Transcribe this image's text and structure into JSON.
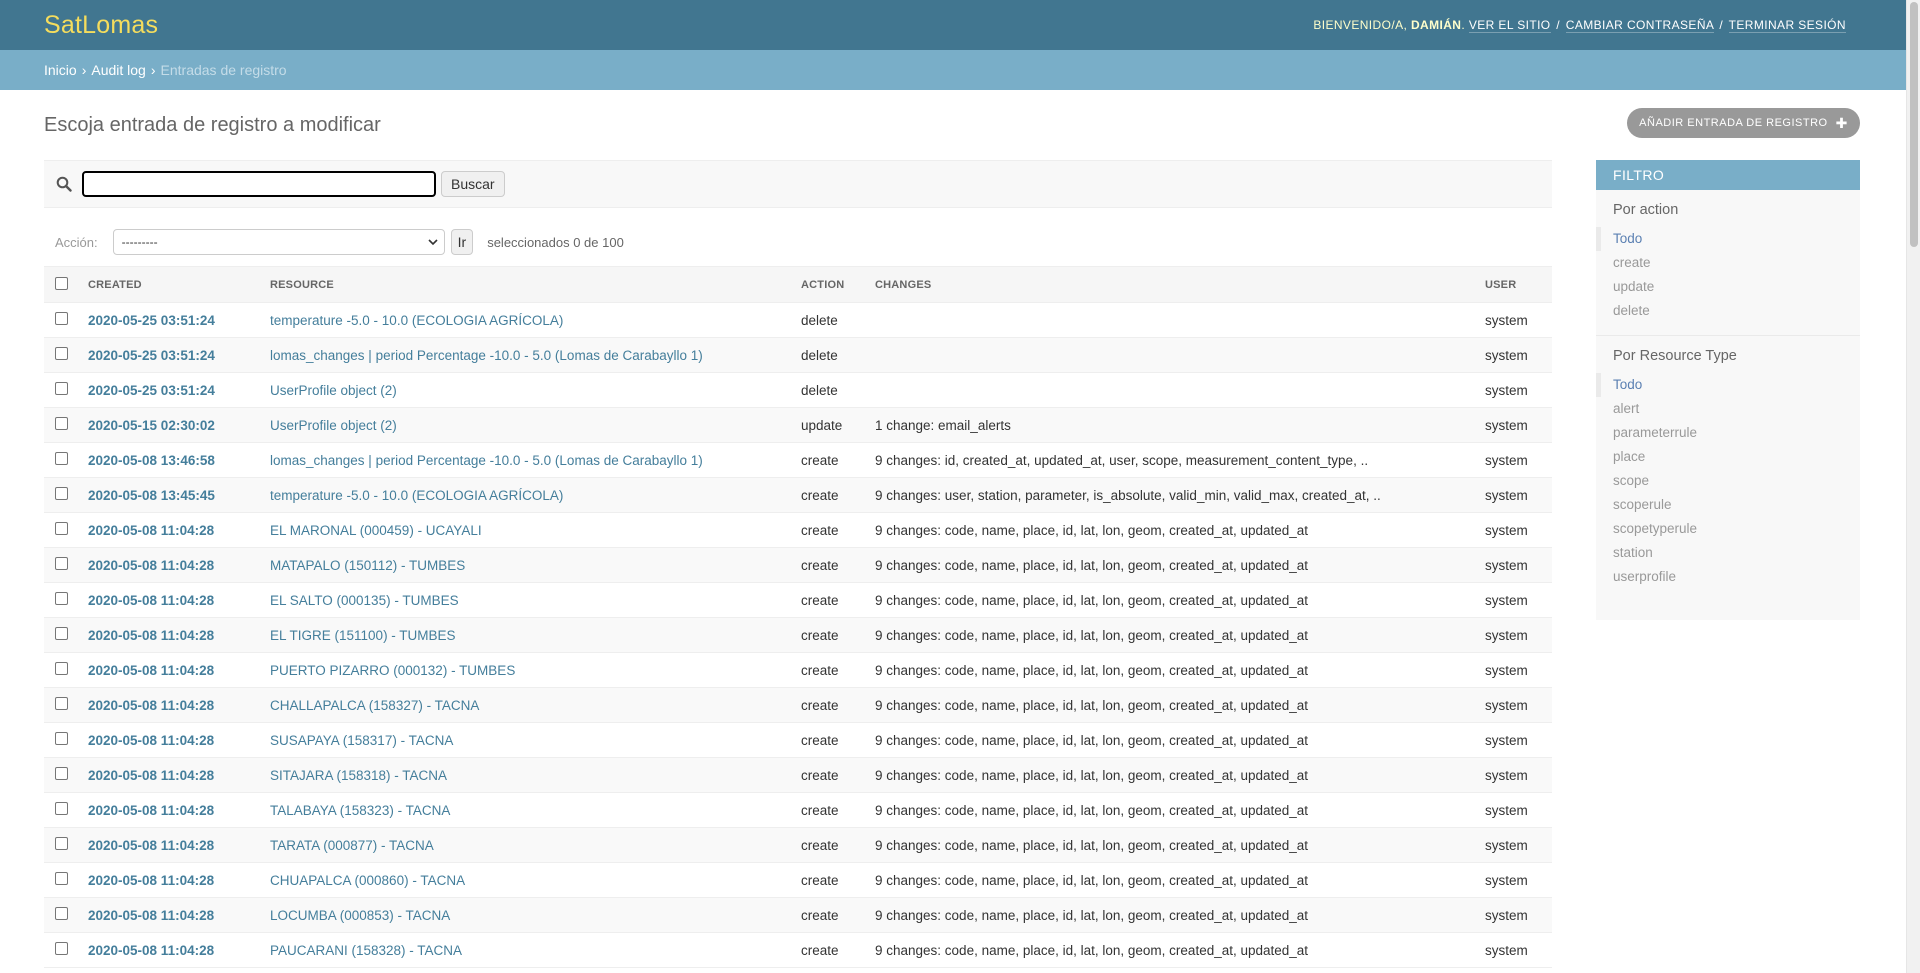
{
  "header": {
    "brand": "SatLomas",
    "welcome": "BIENVENIDO/A,",
    "username": "DAMIÁN",
    "view_site": "VER EL SITIO",
    "change_password": "CAMBIAR CONTRASEÑA",
    "logout": "TERMINAR SESIÓN"
  },
  "breadcrumbs": {
    "home": "Inicio",
    "app": "Audit log",
    "current": "Entradas de registro"
  },
  "page": {
    "title": "Escoja entrada de registro a modificar",
    "add_button": "AÑADIR ENTRADA DE REGISTRO"
  },
  "search": {
    "value": "",
    "button": "Buscar"
  },
  "actions": {
    "label": "Acción:",
    "selected_option": "---------",
    "go_button": "Ir",
    "counter": "seleccionados 0 de 100"
  },
  "table": {
    "columns": {
      "created": "CREATED",
      "resource": "RESOURCE",
      "action": "ACTION",
      "changes": "CHANGES",
      "user": "USER"
    },
    "rows": [
      {
        "created": "2020-05-25 03:51:24",
        "resource": "temperature -5.0 - 10.0 (ECOLOGIA AGRÍCOLA)",
        "action": "delete",
        "changes": "",
        "user": "system"
      },
      {
        "created": "2020-05-25 03:51:24",
        "resource": "lomas_changes | period Percentage -10.0 - 5.0 (Lomas de Carabayllo 1)",
        "action": "delete",
        "changes": "",
        "user": "system"
      },
      {
        "created": "2020-05-25 03:51:24",
        "resource": "UserProfile object (2)",
        "action": "delete",
        "changes": "",
        "user": "system"
      },
      {
        "created": "2020-05-15 02:30:02",
        "resource": "UserProfile object (2)",
        "action": "update",
        "changes": "1 change: email_alerts",
        "user": "system"
      },
      {
        "created": "2020-05-08 13:46:58",
        "resource": "lomas_changes | period Percentage -10.0 - 5.0 (Lomas de Carabayllo 1)",
        "action": "create",
        "changes": "9 changes: id, created_at, updated_at, user, scope, measurement_content_type, ..",
        "user": "system"
      },
      {
        "created": "2020-05-08 13:45:45",
        "resource": "temperature -5.0 - 10.0 (ECOLOGIA AGRÍCOLA)",
        "action": "create",
        "changes": "9 changes: user, station, parameter, is_absolute, valid_min, valid_max, created_at, ..",
        "user": "system"
      },
      {
        "created": "2020-05-08 11:04:28",
        "resource": "EL MARONAL (000459) - UCAYALI",
        "action": "create",
        "changes": "9 changes: code, name, place, id, lat, lon, geom, created_at, updated_at",
        "user": "system"
      },
      {
        "created": "2020-05-08 11:04:28",
        "resource": "MATAPALO (150112) - TUMBES",
        "action": "create",
        "changes": "9 changes: code, name, place, id, lat, lon, geom, created_at, updated_at",
        "user": "system"
      },
      {
        "created": "2020-05-08 11:04:28",
        "resource": "EL SALTO (000135) - TUMBES",
        "action": "create",
        "changes": "9 changes: code, name, place, id, lat, lon, geom, created_at, updated_at",
        "user": "system"
      },
      {
        "created": "2020-05-08 11:04:28",
        "resource": "EL TIGRE (151100) - TUMBES",
        "action": "create",
        "changes": "9 changes: code, name, place, id, lat, lon, geom, created_at, updated_at",
        "user": "system"
      },
      {
        "created": "2020-05-08 11:04:28",
        "resource": "PUERTO PIZARRO (000132) - TUMBES",
        "action": "create",
        "changes": "9 changes: code, name, place, id, lat, lon, geom, created_at, updated_at",
        "user": "system"
      },
      {
        "created": "2020-05-08 11:04:28",
        "resource": "CHALLAPALCA (158327) - TACNA",
        "action": "create",
        "changes": "9 changes: code, name, place, id, lat, lon, geom, created_at, updated_at",
        "user": "system"
      },
      {
        "created": "2020-05-08 11:04:28",
        "resource": "SUSAPAYA (158317) - TACNA",
        "action": "create",
        "changes": "9 changes: code, name, place, id, lat, lon, geom, created_at, updated_at",
        "user": "system"
      },
      {
        "created": "2020-05-08 11:04:28",
        "resource": "SITAJARA (158318) - TACNA",
        "action": "create",
        "changes": "9 changes: code, name, place, id, lat, lon, geom, created_at, updated_at",
        "user": "system"
      },
      {
        "created": "2020-05-08 11:04:28",
        "resource": "TALABAYA (158323) - TACNA",
        "action": "create",
        "changes": "9 changes: code, name, place, id, lat, lon, geom, created_at, updated_at",
        "user": "system"
      },
      {
        "created": "2020-05-08 11:04:28",
        "resource": "TARATA (000877) - TACNA",
        "action": "create",
        "changes": "9 changes: code, name, place, id, lat, lon, geom, created_at, updated_at",
        "user": "system"
      },
      {
        "created": "2020-05-08 11:04:28",
        "resource": "CHUAPALCA (000860) - TACNA",
        "action": "create",
        "changes": "9 changes: code, name, place, id, lat, lon, geom, created_at, updated_at",
        "user": "system"
      },
      {
        "created": "2020-05-08 11:04:28",
        "resource": "LOCUMBA (000853) - TACNA",
        "action": "create",
        "changes": "9 changes: code, name, place, id, lat, lon, geom, created_at, updated_at",
        "user": "system"
      },
      {
        "created": "2020-05-08 11:04:28",
        "resource": "PAUCARANI (158328) - TACNA",
        "action": "create",
        "changes": "9 changes: code, name, place, id, lat, lon, geom, created_at, updated_at",
        "user": "system"
      }
    ]
  },
  "filter": {
    "title": "FILTRO",
    "groups": [
      {
        "title": "Por action",
        "options": [
          "Todo",
          "create",
          "update",
          "delete"
        ],
        "selected": "Todo"
      },
      {
        "title": "Por Resource Type",
        "options": [
          "Todo",
          "alert",
          "parameterrule",
          "place",
          "scope",
          "scoperule",
          "scopetyperule",
          "station",
          "userprofile"
        ],
        "selected": "Todo"
      }
    ]
  },
  "colors": {
    "header_bg": "#417690",
    "breadcrumb_bg": "#79aec8",
    "brand": "#f5dd5d",
    "link": "#447e9b"
  }
}
